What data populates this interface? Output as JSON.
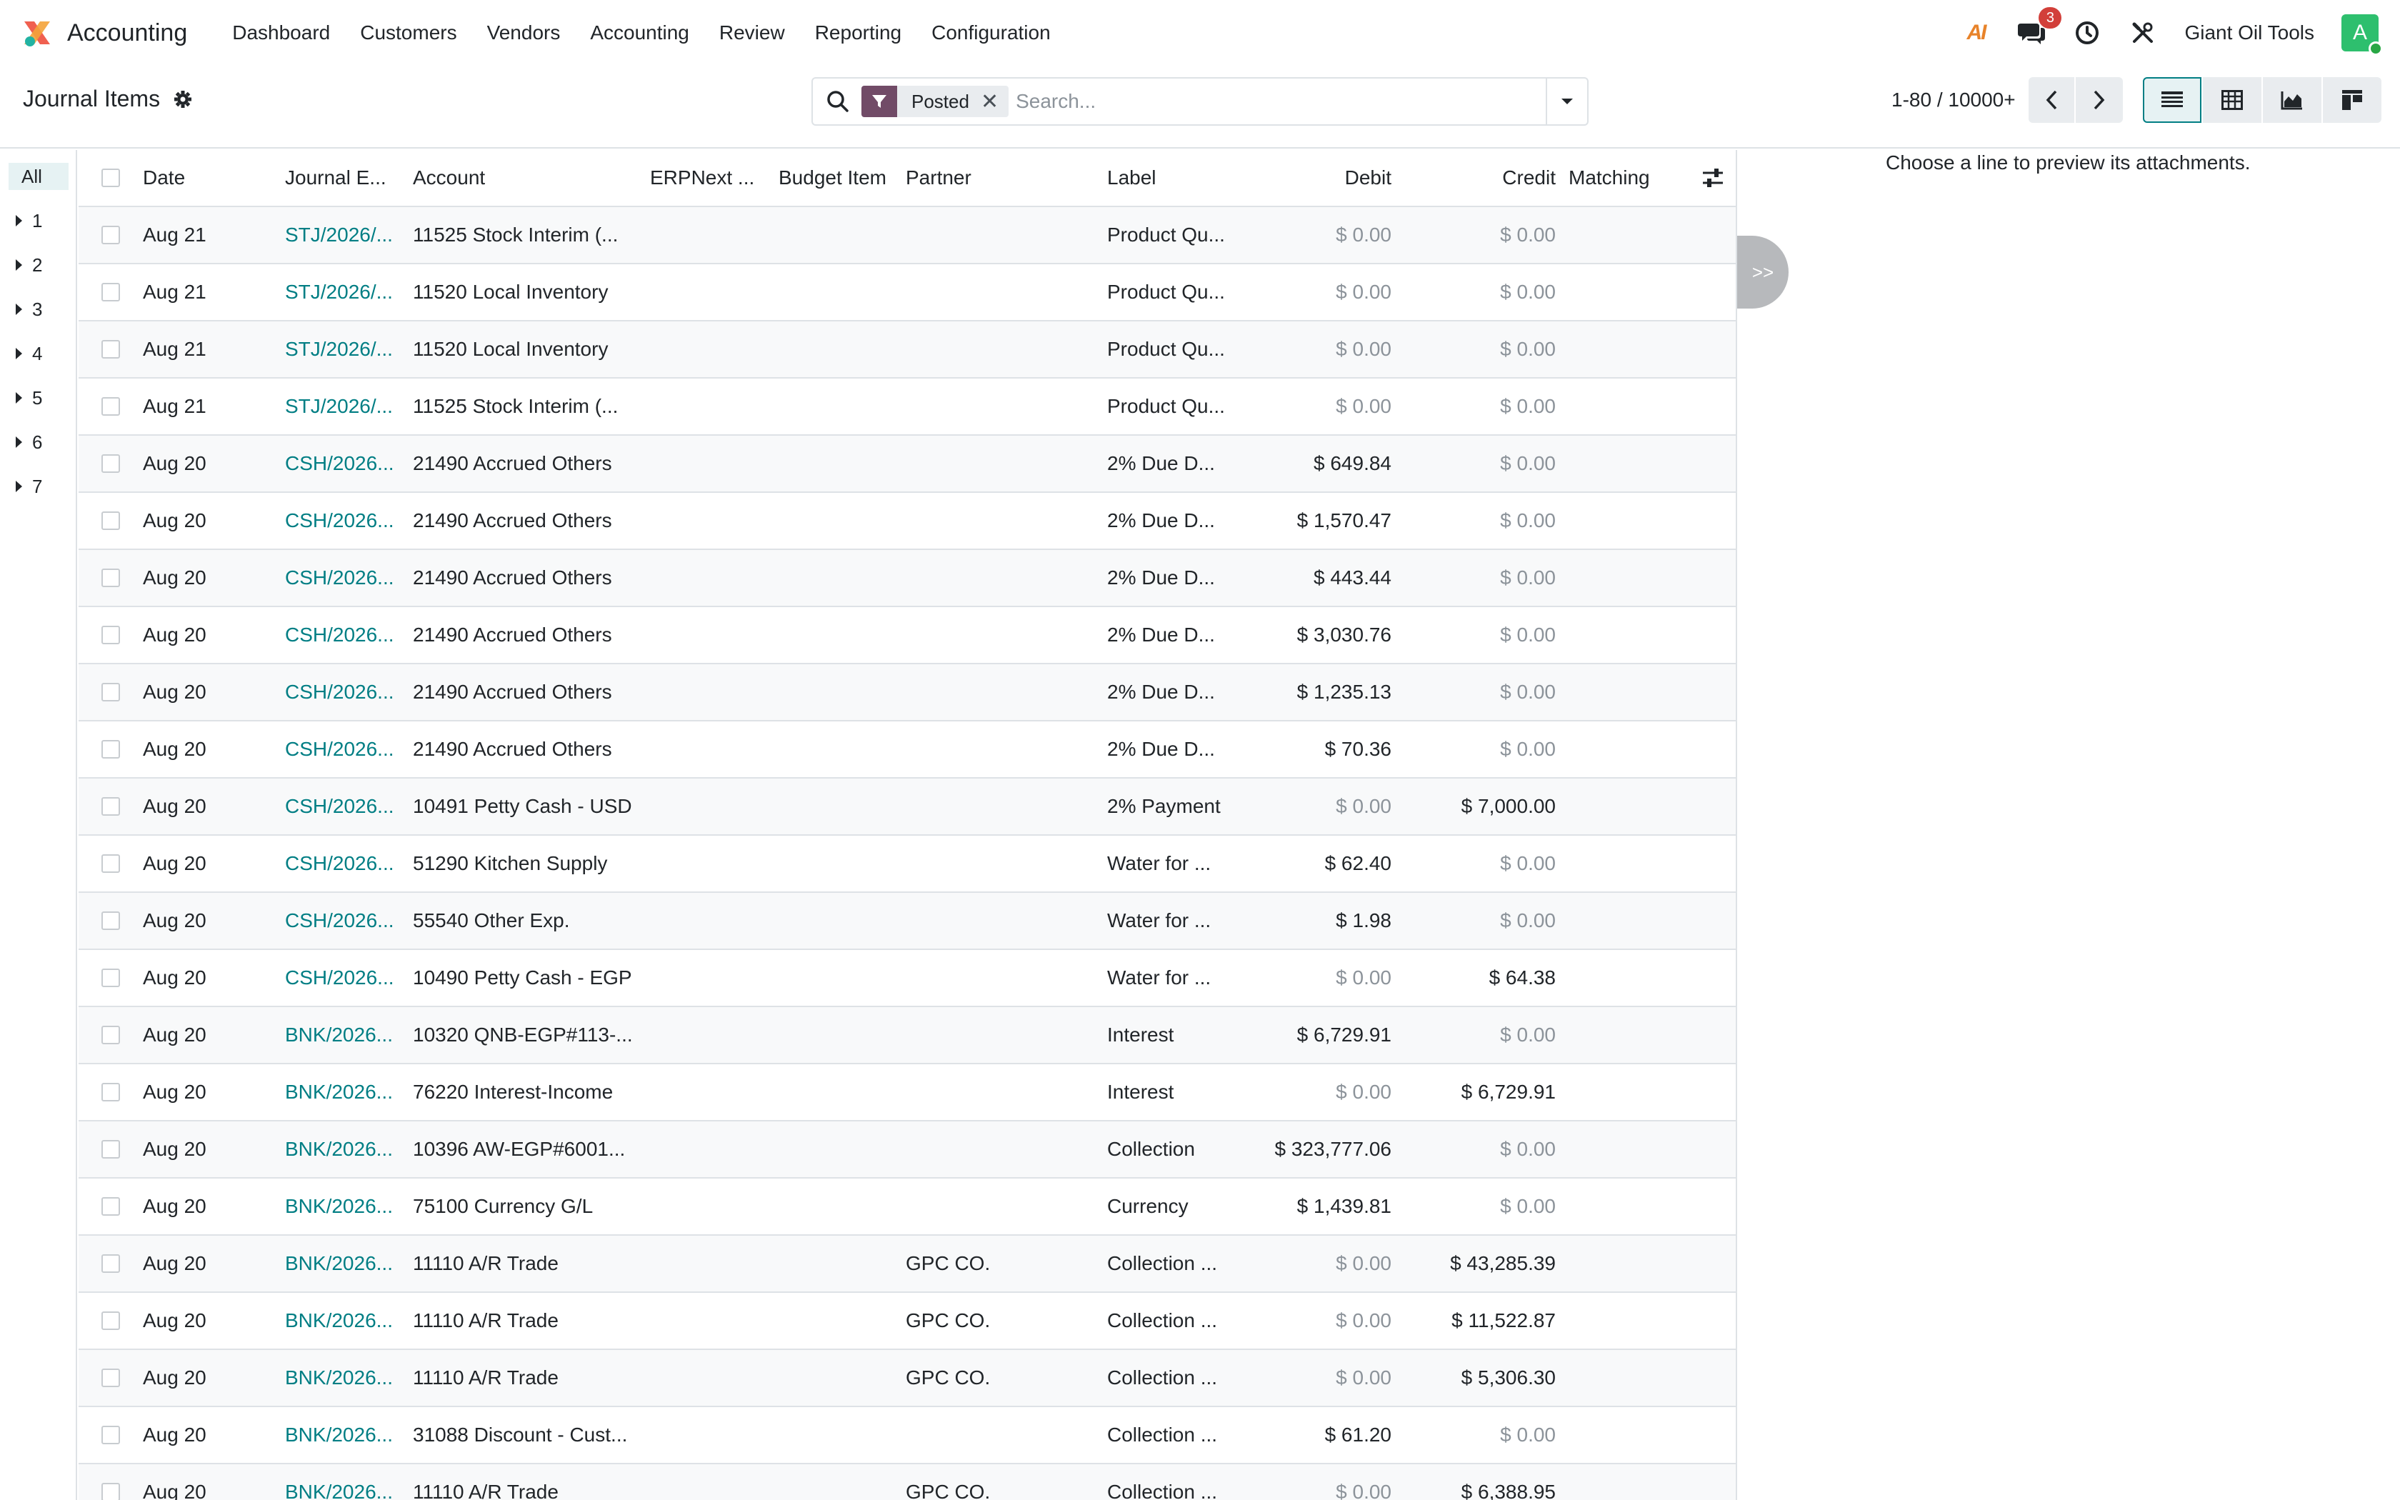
{
  "navbar": {
    "app_name": "Accounting",
    "menu": [
      "Dashboard",
      "Customers",
      "Vendors",
      "Accounting",
      "Review",
      "Reporting",
      "Configuration"
    ],
    "ai_label": "AI",
    "messages_count": "3",
    "company": "Giant Oil Tools",
    "avatar_letter": "A"
  },
  "control": {
    "title": "Journal Items",
    "facet_label": "Posted",
    "search_placeholder": "Search...",
    "pager": "1-80 / 10000+"
  },
  "side_panel": {
    "all_label": "All",
    "items": [
      "1",
      "2",
      "3",
      "4",
      "5",
      "6",
      "7"
    ]
  },
  "table": {
    "columns": {
      "date": "Date",
      "journal_entry": "Journal E...",
      "account": "Account",
      "erpnext": "ERPNext ...",
      "budget_item": "Budget Item",
      "partner": "Partner",
      "label": "Label",
      "debit": "Debit",
      "credit": "Credit",
      "matching": "Matching"
    },
    "rows": [
      {
        "date": "Aug 21",
        "je": "STJ/2026/...",
        "account": "11525 Stock Interim (...",
        "partner": "",
        "label": "Product Qu...",
        "debit": "$ 0.00",
        "credit": "$ 0.00"
      },
      {
        "date": "Aug 21",
        "je": "STJ/2026/...",
        "account": "11520 Local Inventory",
        "partner": "",
        "label": "Product Qu...",
        "debit": "$ 0.00",
        "credit": "$ 0.00"
      },
      {
        "date": "Aug 21",
        "je": "STJ/2026/...",
        "account": "11520 Local Inventory",
        "partner": "",
        "label": "Product Qu...",
        "debit": "$ 0.00",
        "credit": "$ 0.00"
      },
      {
        "date": "Aug 21",
        "je": "STJ/2026/...",
        "account": "11525 Stock Interim (...",
        "partner": "",
        "label": "Product Qu...",
        "debit": "$ 0.00",
        "credit": "$ 0.00"
      },
      {
        "date": "Aug 20",
        "je": "CSH/2026...",
        "account": "21490 Accrued Others",
        "partner": "",
        "label": "2% Due D...",
        "debit": "$ 649.84",
        "credit": "$ 0.00"
      },
      {
        "date": "Aug 20",
        "je": "CSH/2026...",
        "account": "21490 Accrued Others",
        "partner": "",
        "label": "2% Due D...",
        "debit": "$ 1,570.47",
        "credit": "$ 0.00"
      },
      {
        "date": "Aug 20",
        "je": "CSH/2026...",
        "account": "21490 Accrued Others",
        "partner": "",
        "label": "2% Due D...",
        "debit": "$ 443.44",
        "credit": "$ 0.00"
      },
      {
        "date": "Aug 20",
        "je": "CSH/2026...",
        "account": "21490 Accrued Others",
        "partner": "",
        "label": "2% Due D...",
        "debit": "$ 3,030.76",
        "credit": "$ 0.00"
      },
      {
        "date": "Aug 20",
        "je": "CSH/2026...",
        "account": "21490 Accrued Others",
        "partner": "",
        "label": "2% Due D...",
        "debit": "$ 1,235.13",
        "credit": "$ 0.00"
      },
      {
        "date": "Aug 20",
        "je": "CSH/2026...",
        "account": "21490 Accrued Others",
        "partner": "",
        "label": "2% Due D...",
        "debit": "$ 70.36",
        "credit": "$ 0.00"
      },
      {
        "date": "Aug 20",
        "je": "CSH/2026...",
        "account": "10491 Petty Cash - USD",
        "partner": "",
        "label": "2% Payment",
        "debit": "$ 0.00",
        "credit": "$ 7,000.00"
      },
      {
        "date": "Aug 20",
        "je": "CSH/2026...",
        "account": "51290 Kitchen Supply",
        "partner": "",
        "label": "Water for ...",
        "debit": "$ 62.40",
        "credit": "$ 0.00"
      },
      {
        "date": "Aug 20",
        "je": "CSH/2026...",
        "account": "55540 Other Exp.",
        "partner": "",
        "label": "Water for ...",
        "debit": "$ 1.98",
        "credit": "$ 0.00"
      },
      {
        "date": "Aug 20",
        "je": "CSH/2026...",
        "account": "10490 Petty Cash - EGP",
        "partner": "",
        "label": "Water for ...",
        "debit": "$ 0.00",
        "credit": "$ 64.38"
      },
      {
        "date": "Aug 20",
        "je": "BNK/2026...",
        "account": "10320 QNB-EGP#113-...",
        "partner": "",
        "label": "Interest",
        "debit": "$ 6,729.91",
        "credit": "$ 0.00"
      },
      {
        "date": "Aug 20",
        "je": "BNK/2026...",
        "account": "76220 Interest-Income",
        "partner": "",
        "label": "Interest",
        "debit": "$ 0.00",
        "credit": "$ 6,729.91"
      },
      {
        "date": "Aug 20",
        "je": "BNK/2026...",
        "account": "10396 AW-EGP#6001...",
        "partner": "",
        "label": "Collection",
        "debit": "$ 323,777.06",
        "credit": "$ 0.00"
      },
      {
        "date": "Aug 20",
        "je": "BNK/2026...",
        "account": "75100 Currency G/L",
        "partner": "",
        "label": "Currency",
        "debit": "$ 1,439.81",
        "credit": "$ 0.00"
      },
      {
        "date": "Aug 20",
        "je": "BNK/2026...",
        "account": "11110 A/R Trade",
        "partner": "GPC CO.",
        "label": "Collection ...",
        "debit": "$ 0.00",
        "credit": "$ 43,285.39"
      },
      {
        "date": "Aug 20",
        "je": "BNK/2026...",
        "account": "11110 A/R Trade",
        "partner": "GPC CO.",
        "label": "Collection ...",
        "debit": "$ 0.00",
        "credit": "$ 11,522.87"
      },
      {
        "date": "Aug 20",
        "je": "BNK/2026...",
        "account": "11110 A/R Trade",
        "partner": "GPC CO.",
        "label": "Collection ...",
        "debit": "$ 0.00",
        "credit": "$ 5,306.30"
      },
      {
        "date": "Aug 20",
        "je": "BNK/2026...",
        "account": "31088 Discount - Cust...",
        "partner": "",
        "label": "Collection ...",
        "debit": "$ 61.20",
        "credit": "$ 0.00"
      },
      {
        "date": "Aug 20",
        "je": "BNK/2026...",
        "account": "11110 A/R Trade",
        "partner": "GPC CO.",
        "label": "Collection ...",
        "debit": "$ 0.00",
        "credit": "$ 6,388.95"
      }
    ]
  },
  "preview": {
    "message": "Choose a line to preview its attachments.",
    "collapse_label": ">>"
  },
  "icons": {
    "logo": "accounting-logo-icon",
    "messages": "chat-icon",
    "activity": "clock-icon",
    "tools": "tools-icon",
    "settings": "gear-icon",
    "search": "search-icon",
    "filter": "filter-icon",
    "dropdown": "caret-down-icon",
    "prev": "chevron-left-icon",
    "next": "chevron-right-icon",
    "list_view": "list-view-icon",
    "pivot_view": "pivot-view-icon",
    "graph_view": "graph-view-icon",
    "kanban_view": "kanban-view-icon",
    "optional_columns": "sliders-icon"
  },
  "colors": {
    "link": "#017e84",
    "brand": "#714b67",
    "badge": "#d23f3a",
    "avatar": "#2ebf6e",
    "muted": "#8c939a"
  }
}
